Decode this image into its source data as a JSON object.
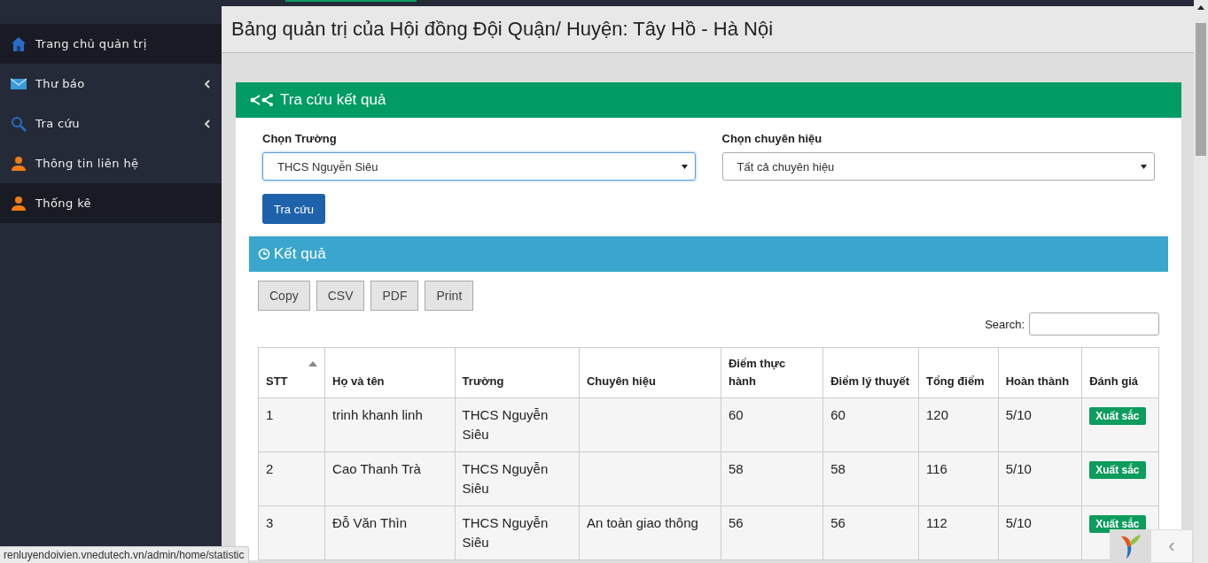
{
  "sidebar": {
    "items": [
      {
        "label": "Trang chủ quản trị",
        "kind": "home",
        "highlighted": true,
        "has_submenu": false
      },
      {
        "label": "Thư báo",
        "kind": "mail",
        "highlighted": false,
        "has_submenu": true
      },
      {
        "label": "Tra cứu",
        "kind": "search",
        "highlighted": false,
        "has_submenu": true
      },
      {
        "label": "Thông tin liên hệ",
        "kind": "user",
        "highlighted": false,
        "has_submenu": false
      },
      {
        "label": "Thống kê",
        "kind": "user",
        "highlighted": true,
        "has_submenu": false
      }
    ]
  },
  "page_title": "Bảng quản trị của Hội đồng Đội Quận/ Huyện: Tây Hồ - Hà Nội",
  "search_panel": {
    "title": "Tra cứu kết quả",
    "fields": [
      {
        "label": "Chọn Trường",
        "value": "THCS Nguyễn Siêu",
        "focused": true
      },
      {
        "label": "Chọn chuyên hiệu",
        "value": "Tất cả chuyên hiệu",
        "focused": false
      }
    ],
    "submit": "Tra cứu"
  },
  "results": {
    "title": "Kết quả",
    "export_buttons": [
      "Copy",
      "CSV",
      "PDF",
      "Print"
    ],
    "search_label": "Search:",
    "table": {
      "columns": [
        {
          "label": "STT",
          "sorted": true
        },
        {
          "label": "Họ và tên",
          "sorted": false
        },
        {
          "label": "Trường",
          "sorted": false
        },
        {
          "label": "Chuyên hiệu",
          "sorted": false
        },
        {
          "label": "Điểm thực hành",
          "sorted": false
        },
        {
          "label": "Điểm lý thuyết",
          "sorted": false
        },
        {
          "label": "Tổng điểm",
          "sorted": false
        },
        {
          "label": "Hoàn thành",
          "sorted": false
        },
        {
          "label": "Đánh giá",
          "sorted": false
        }
      ],
      "rows": [
        {
          "cells": [
            "1",
            "trinh khanh linh",
            "THCS Nguyễn Siêu",
            "",
            "60",
            "60",
            "120",
            "5/10"
          ],
          "rating": "Xuất sắc"
        },
        {
          "cells": [
            "2",
            "Cao Thanh Trà",
            "THCS Nguyễn Siêu",
            "",
            "58",
            "58",
            "116",
            "5/10"
          ],
          "rating": "Xuất sắc"
        },
        {
          "cells": [
            "3",
            "Đỗ Văn Thìn",
            "THCS Nguyễn Siêu",
            "An toàn giao thông",
            "56",
            "56",
            "112",
            "5/10"
          ],
          "rating": "Xuất sắc"
        }
      ]
    }
  },
  "status_bar": {
    "url": "renluyendoivien.vnedutech.vn/admin/home/statistic"
  },
  "debug_toolbar": {
    "collapse": "‹"
  }
}
